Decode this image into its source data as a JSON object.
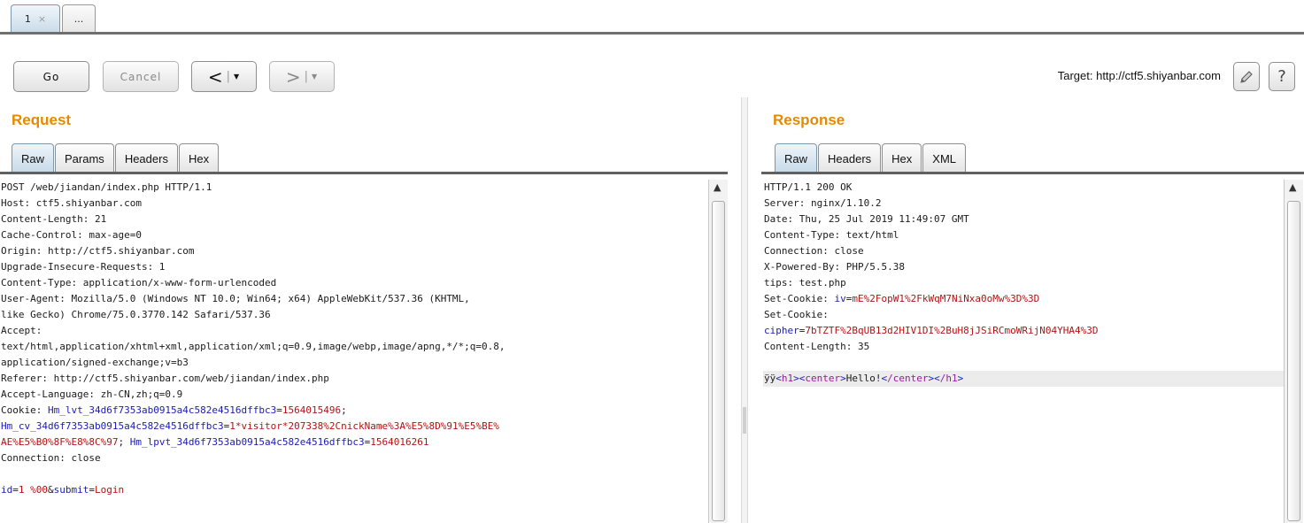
{
  "tabs": [
    {
      "label": "1",
      "close": "×"
    },
    {
      "label": "..."
    }
  ],
  "toolbar": {
    "go_label": "Go",
    "cancel_label": "Cancel",
    "back_arrow": "<",
    "forward_arrow": ">",
    "dropdown_glyph": "▼",
    "target_text": "Target: http://ctf5.shiyanbar.com",
    "help_label": "?"
  },
  "request": {
    "title": "Request",
    "tabs": [
      "Raw",
      "Params",
      "Headers",
      "Hex"
    ],
    "lines": [
      "POST /web/jiandan/index.php HTTP/1.1",
      "Host: ctf5.shiyanbar.com",
      "Content-Length: 21",
      "Cache-Control: max-age=0",
      "Origin: http://ctf5.shiyanbar.com",
      "Upgrade-Insecure-Requests: 1",
      "Content-Type: application/x-www-form-urlencoded",
      "User-Agent: Mozilla/5.0 (Windows NT 10.0; Win64; x64) AppleWebKit/537.36 (KHTML,",
      "like Gecko) Chrome/75.0.3770.142 Safari/537.36",
      "Accept:",
      "text/html,application/xhtml+xml,application/xml;q=0.9,image/webp,image/apng,*/*;q=0.8,",
      "application/signed-exchange;v=b3",
      "Referer: http://ctf5.shiyanbar.com/web/jiandan/index.php",
      "Accept-Language: zh-CN,zh;q=0.9"
    ],
    "cookie_label": "Cookie: ",
    "cookie_k1": "Hm_lvt_34d6f7353ab0915a4c582e4516dffbc3",
    "cookie_v1": "1564015496",
    "cookie_k2": "Hm_cv_34d6f7353ab0915a4c582e4516dffbc3",
    "cookie_v2a": "1*visitor*207338%2CnickName%3A%E5%8D%91%E5%BE%",
    "cookie_v2b": "AE%E5%B0%8F%E8%8C%97",
    "cookie_k3": "Hm_lpvt_34d6f7353ab0915a4c582e4516dffbc3",
    "cookie_v3": "1564016261",
    "connection_line": "Connection: close",
    "body_k1": "id",
    "body_v1": "1 %00",
    "body_k2": "submit",
    "body_v2": "Login"
  },
  "response": {
    "title": "Response",
    "tabs": [
      "Raw",
      "Headers",
      "Hex",
      "XML"
    ],
    "lines": [
      "HTTP/1.1 200 OK",
      "Server: nginx/1.10.2",
      "Date: Thu, 25 Jul 2019 11:49:07 GMT",
      "Content-Type: text/html",
      "Connection: close",
      "X-Powered-By: PHP/5.5.38",
      "tips: test.php"
    ],
    "setcookie_label": "Set-Cookie: ",
    "iv_key": "iv",
    "iv_value": "mE%2FopW1%2FkWqM7NiNxa0oMw%3D%3D",
    "setcookie2_label": "Set-Cookie:",
    "cipher_key": "cipher",
    "cipher_value": "7bTZTF%2BqUB13d2HIV1DI%2BuH8jJSiRCmoWRijN04YHA4%3D",
    "content_length_line": "Content-Length: 35",
    "html_prefix": "ÿÿ",
    "html_h1_open": "h1",
    "html_center_open": "center",
    "html_text": "Hello!",
    "html_center_close": "/center",
    "html_h1_close": "/h1"
  }
}
